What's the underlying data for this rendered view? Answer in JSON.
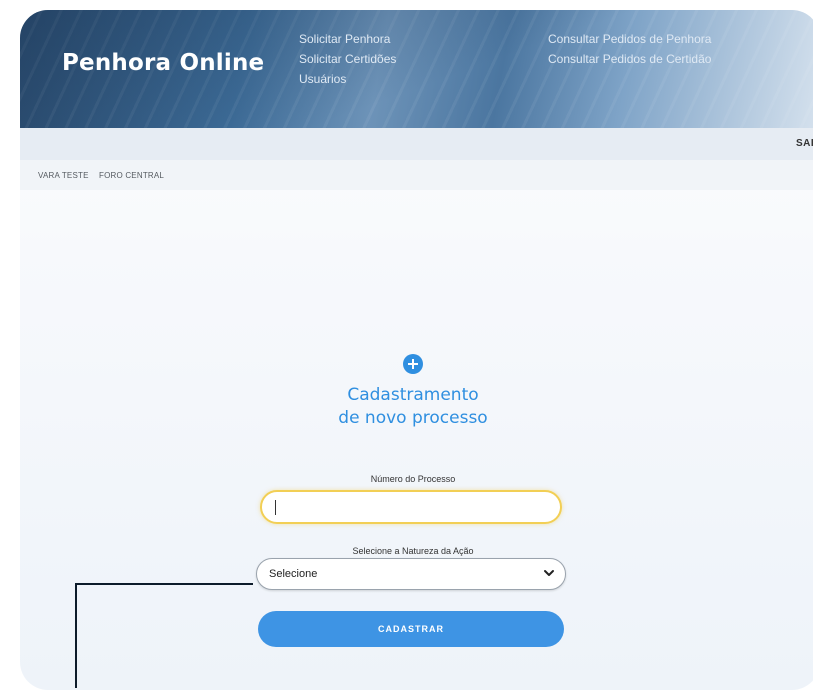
{
  "header": {
    "brand": "Penhora Online",
    "nav": [
      "Solicitar Penhora",
      "Solicitar Certidões",
      "Usuários",
      "Consultar Pedidos de Penhora",
      "Consultar Pedidos de Certidão"
    ]
  },
  "subbar": {
    "logout_label": "SAIR"
  },
  "breadcrumb": {
    "vara": "VARA TESTE",
    "foro": "FORO CENTRAL"
  },
  "form": {
    "title_line1": "Cadastramento",
    "title_line2": "de novo processo",
    "process_number_label": "Número do Processo",
    "process_number_value": "",
    "nature_label": "Selecione a Natureza da Ação",
    "nature_selected": "Selecione",
    "submit_label": "CADASTRAR"
  },
  "colors": {
    "accent": "#2f8fe0",
    "button": "#3e94e4",
    "focus_border": "#f2cf55",
    "callout_line": "#0d1b2a"
  }
}
